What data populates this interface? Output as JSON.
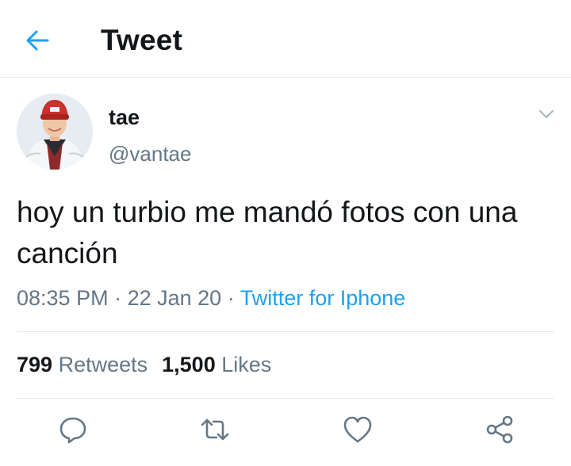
{
  "header": {
    "title": "Tweet",
    "back_icon": "back-arrow-icon"
  },
  "author": {
    "display_name": "tae",
    "handle": "@vantae"
  },
  "tweet": {
    "text": "hoy un turbio me mandó fotos con una canción"
  },
  "meta": {
    "time": "08:35 PM",
    "sep1": " · ",
    "date": "22 Jan 20",
    "sep2": " · ",
    "source": "Twitter for Iphone"
  },
  "stats": {
    "retweets_count": "799",
    "retweets_label": "Retweets",
    "likes_count": "1,500",
    "likes_label": "Likes"
  },
  "actions": [
    "reply-icon",
    "retweet-icon",
    "like-icon",
    "share-icon"
  ],
  "colors": {
    "accent": "#1da1f2",
    "text_primary": "#14171a",
    "text_secondary": "#657786",
    "border": "#e1e8ed"
  }
}
